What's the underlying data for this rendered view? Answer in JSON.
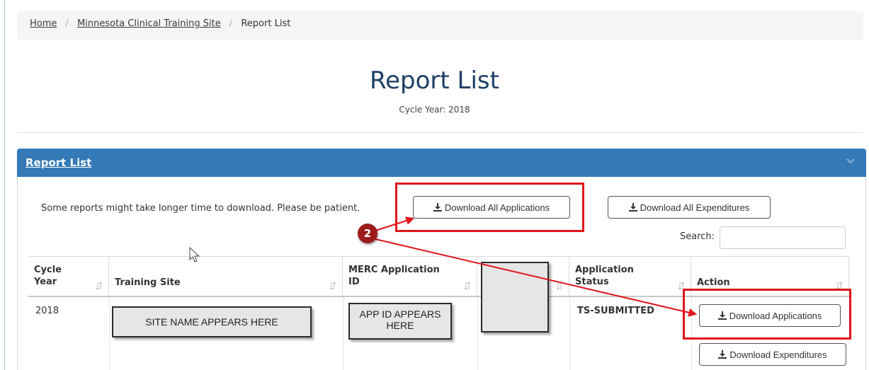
{
  "breadcrumb": {
    "items": [
      "Home",
      "Minnesota Clinical Training Site"
    ],
    "current": "Report List",
    "separator": "/"
  },
  "page": {
    "title": "Report List",
    "cycle_year_line": "Cycle Year: 2018"
  },
  "panel": {
    "title": "Report List",
    "note": "Some reports might take longer time to download. Please be patient.",
    "download_all_applications": "Download All Applications",
    "download_all_expenditures": "Download All Expenditures",
    "search_label": "Search:",
    "search_value": ""
  },
  "table": {
    "headers": {
      "cycle_year": [
        "Cycle",
        "Year"
      ],
      "training_site": "Training Site",
      "merc_id": [
        "MERC Application",
        "ID"
      ],
      "app_status": [
        "Application",
        "Status"
      ],
      "action": "Action"
    },
    "row": {
      "cycle_year": "2018",
      "site_placeholder": "SITE NAME APPEARS HERE",
      "app_id_placeholder": [
        "APP ID APPEARS",
        "HERE"
      ],
      "status": "TS-SUBMITTED",
      "download_applications": "Download Applications",
      "download_expenditures": "Download Expenditures"
    }
  },
  "annotation": {
    "step_number": "2",
    "highlight_color": "#e0151c"
  },
  "colors": {
    "panel_header": "#337ab7",
    "title": "#1e3f66"
  }
}
